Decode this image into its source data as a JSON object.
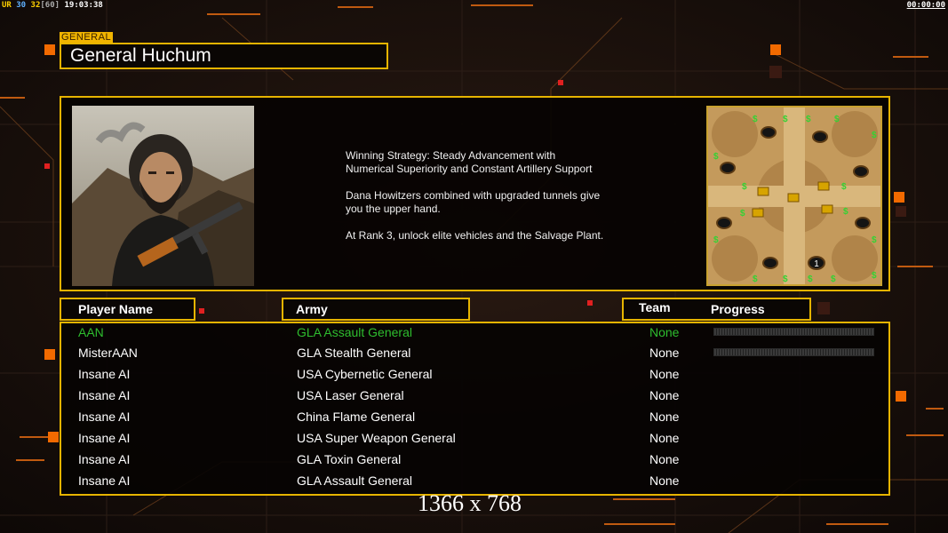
{
  "status_bar": {
    "left": {
      "ur": "UR",
      "n1": "30",
      "n2": "32",
      "n3": "[60]",
      "clock": "19:03:38"
    },
    "right": "00:00:00"
  },
  "header": {
    "rank_tag": "GENERAL",
    "general_name": "General Huchum"
  },
  "description": {
    "paragraphs": [
      "Winning Strategy: Steady Advancement with\n Numerical Superiority and Constant Artillery Support",
      "Dana Howitzers combined with upgraded tunnels give\n you the upper hand.",
      "At Rank 3, unlock elite vehicles and the Salvage Plant."
    ]
  },
  "minimap": {
    "start_marker": "1",
    "supply_symbol": "$"
  },
  "columns": {
    "player_name": "Player Name",
    "army": "Army",
    "team": "Team",
    "progress": "Progress"
  },
  "players": [
    {
      "name": "AAN",
      "army": "GLA Assault General",
      "team": "None",
      "progress_bar": true,
      "local": true
    },
    {
      "name": "MisterAAN",
      "army": "GLA Stealth General",
      "team": "None",
      "progress_bar": true,
      "local": false
    },
    {
      "name": "Insane AI",
      "army": "USA Cybernetic General",
      "team": "None",
      "progress_bar": false,
      "local": false
    },
    {
      "name": "Insane AI",
      "army": "USA Laser General",
      "team": "None",
      "progress_bar": false,
      "local": false
    },
    {
      "name": "Insane AI",
      "army": "China Flame General",
      "team": "None",
      "progress_bar": false,
      "local": false
    },
    {
      "name": "Insane AI",
      "army": "USA Super Weapon General",
      "team": "None",
      "progress_bar": false,
      "local": false
    },
    {
      "name": "Insane AI",
      "army": "GLA Toxin General",
      "team": "None",
      "progress_bar": false,
      "local": false
    },
    {
      "name": "Insane AI",
      "army": "GLA Assault General",
      "team": "None",
      "progress_bar": false,
      "local": false
    }
  ],
  "overlay": {
    "resolution": "1366 x 768"
  },
  "colors": {
    "accent": "#e6b400",
    "local_player": "#2ebd2e",
    "background": "#120b08"
  }
}
